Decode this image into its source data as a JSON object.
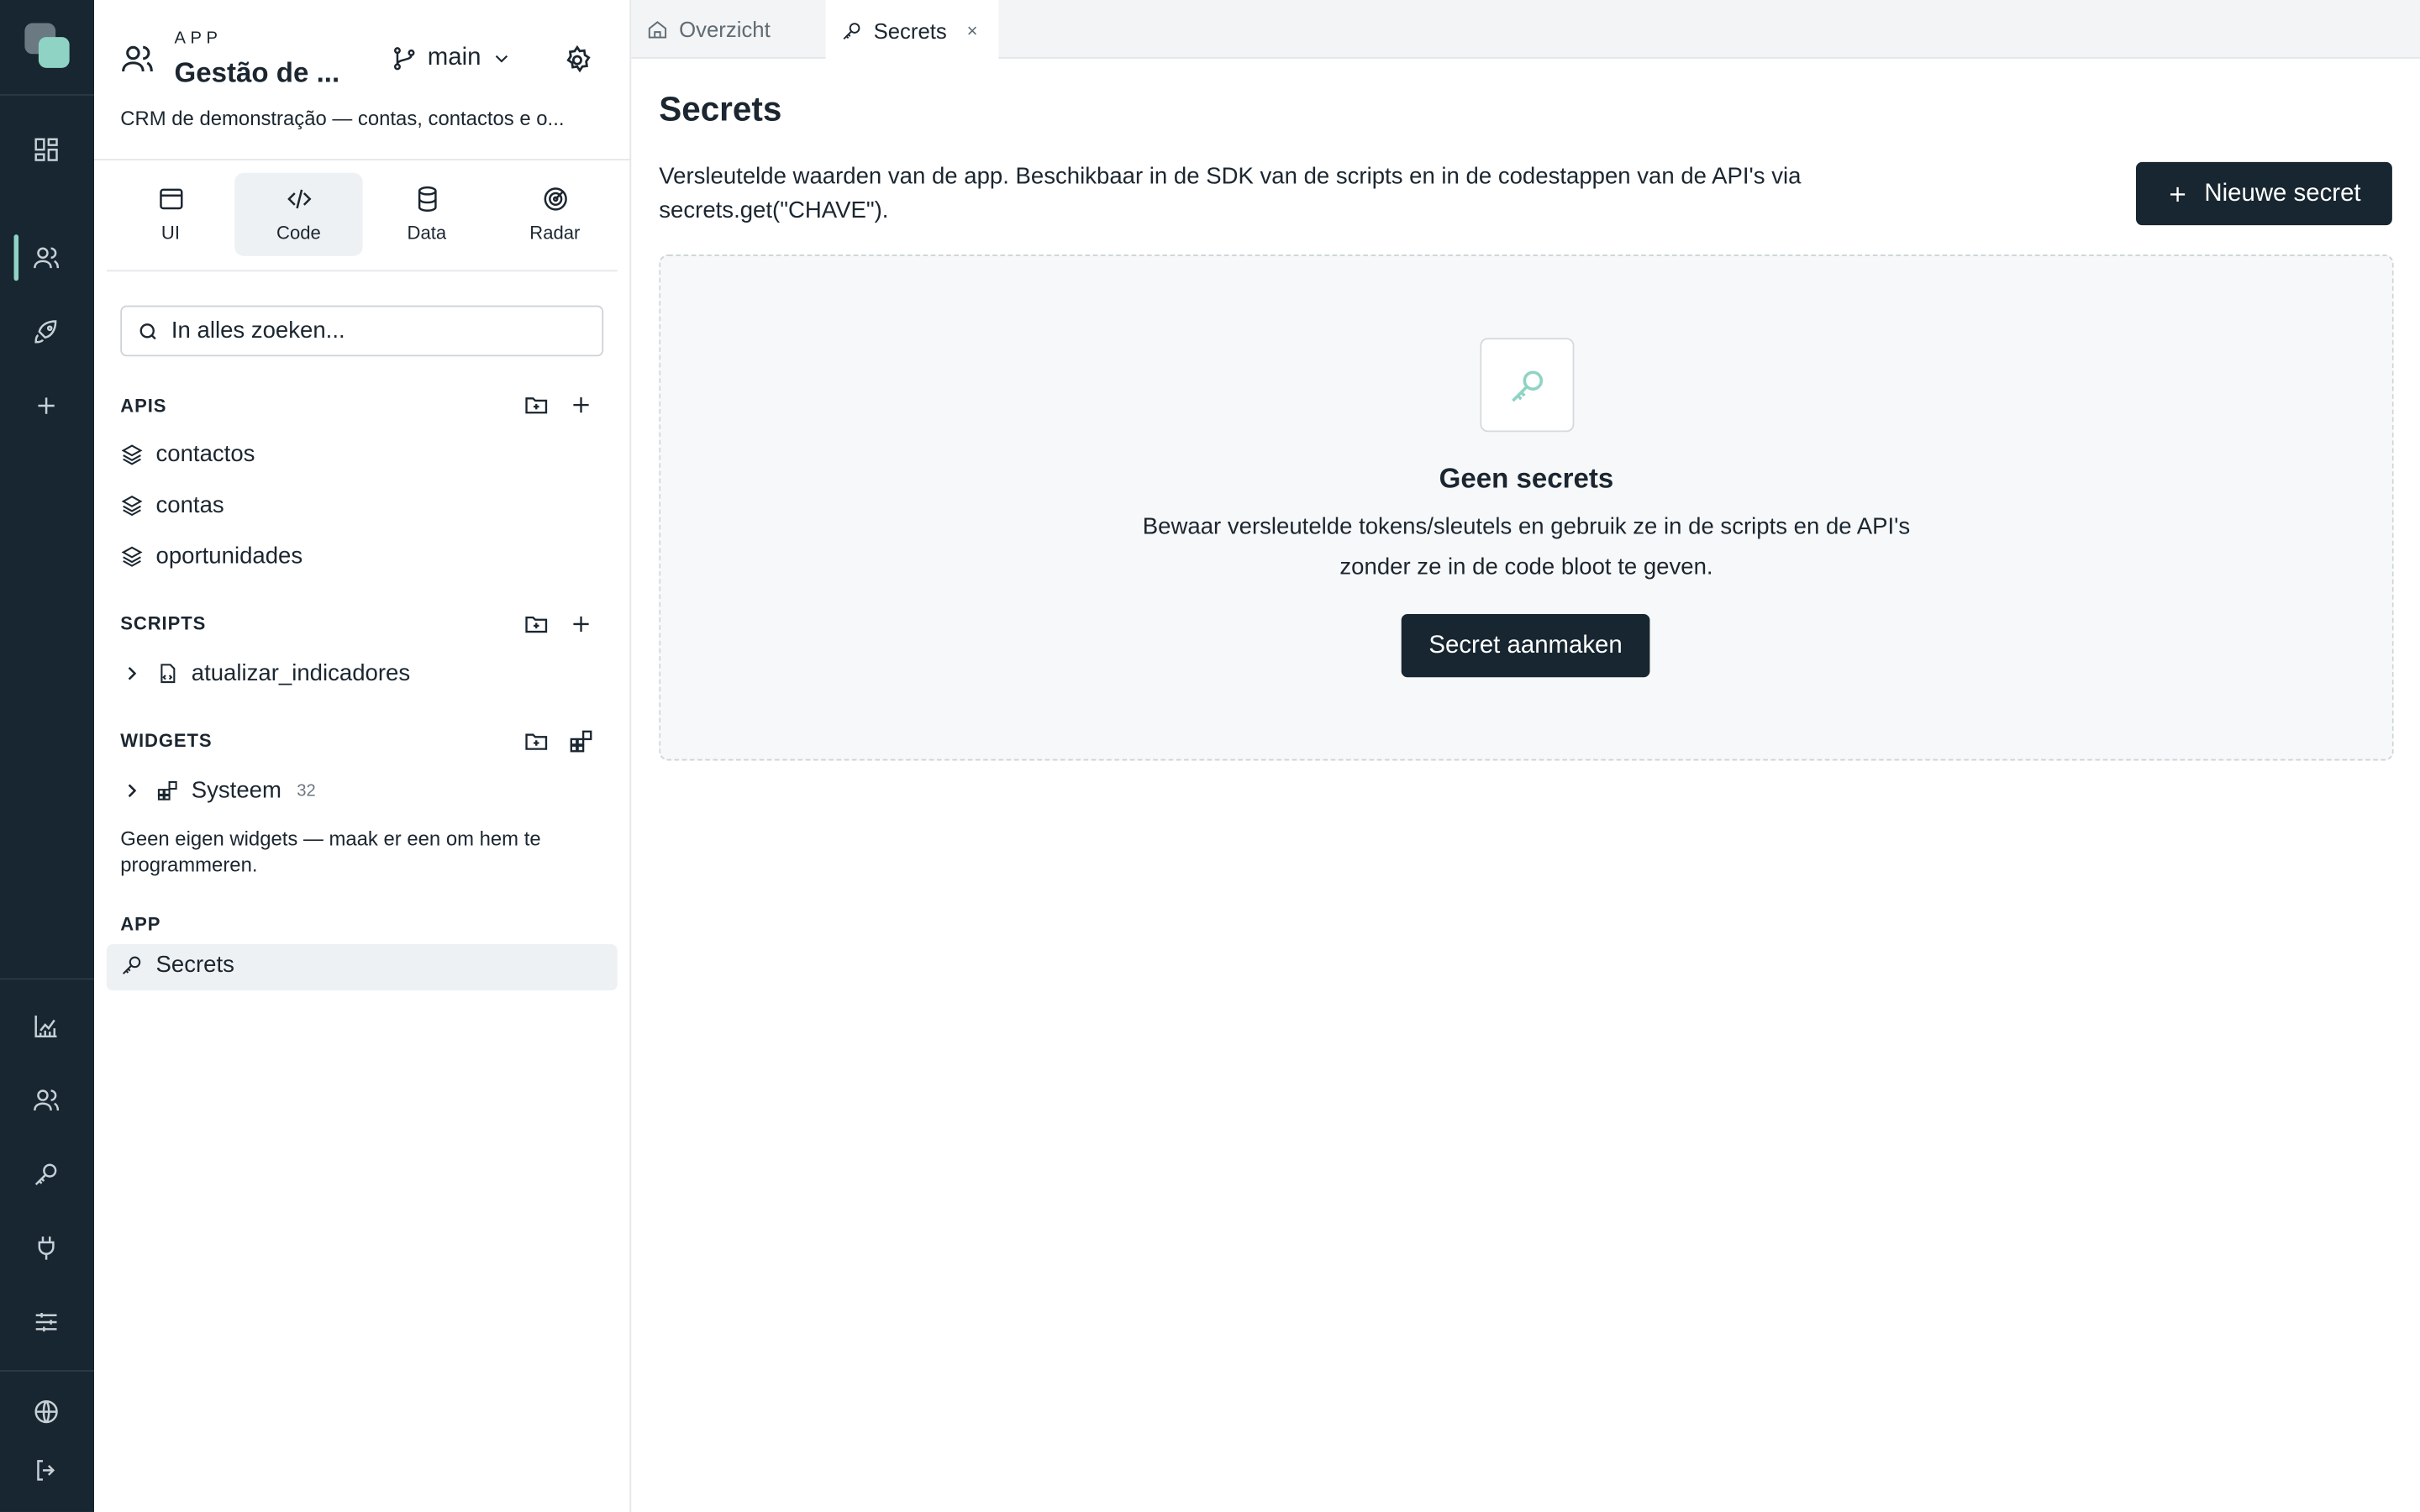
{
  "rail": {
    "top_icons": [
      "dashboard-icon",
      "users-icon",
      "rocket-icon",
      "plus-icon"
    ],
    "bottom_icons": [
      "chart-icon",
      "users-icon",
      "key-icon",
      "plug-icon",
      "sliders-icon",
      "globe-icon",
      "logout-icon"
    ],
    "accent": "#8fd3c4",
    "background": "#172630"
  },
  "app": {
    "kicker": "APP",
    "name": "Gestão de ...",
    "branch": "main",
    "description": "CRM de demonstração — contas, contactos e o..."
  },
  "mode_tabs": [
    {
      "label": "UI",
      "icon": "window-icon"
    },
    {
      "label": "Code",
      "icon": "code-icon",
      "active": true
    },
    {
      "label": "Data",
      "icon": "database-icon"
    },
    {
      "label": "Radar",
      "icon": "radar-icon"
    }
  ],
  "search": {
    "placeholder": "In alles zoeken..."
  },
  "sections": {
    "apis": {
      "title": "APIS",
      "items": [
        "contactos",
        "contas",
        "oportunidades"
      ]
    },
    "scripts": {
      "title": "SCRIPTS",
      "items": [
        "atualizar_indicadores"
      ]
    },
    "widgets": {
      "title": "WIDGETS",
      "group": "Systeem",
      "group_count": "32",
      "hint": "Geen eigen widgets — maak er een om hem te programmeren."
    },
    "app": {
      "title": "APP",
      "items": [
        "Secrets"
      ]
    }
  },
  "tabs": [
    {
      "label": "Overzicht",
      "icon": "home-icon"
    },
    {
      "label": "Secrets",
      "icon": "key-icon",
      "active": true,
      "close": "×"
    }
  ],
  "main": {
    "title": "Secrets",
    "description": "Versleutelde waarden van de app. Beschikbaar in de SDK van de scripts en in de codestappen van de API's via secrets.get(\"CHAVE\").",
    "new_button": "Nieuwe secret",
    "empty": {
      "title": "Geen secrets",
      "text": "Bewaar versleutelde tokens/sleutels en gebruik ze in de scripts en de API's zonder ze in de code bloot te geven.",
      "button": "Secret aanmaken"
    }
  }
}
